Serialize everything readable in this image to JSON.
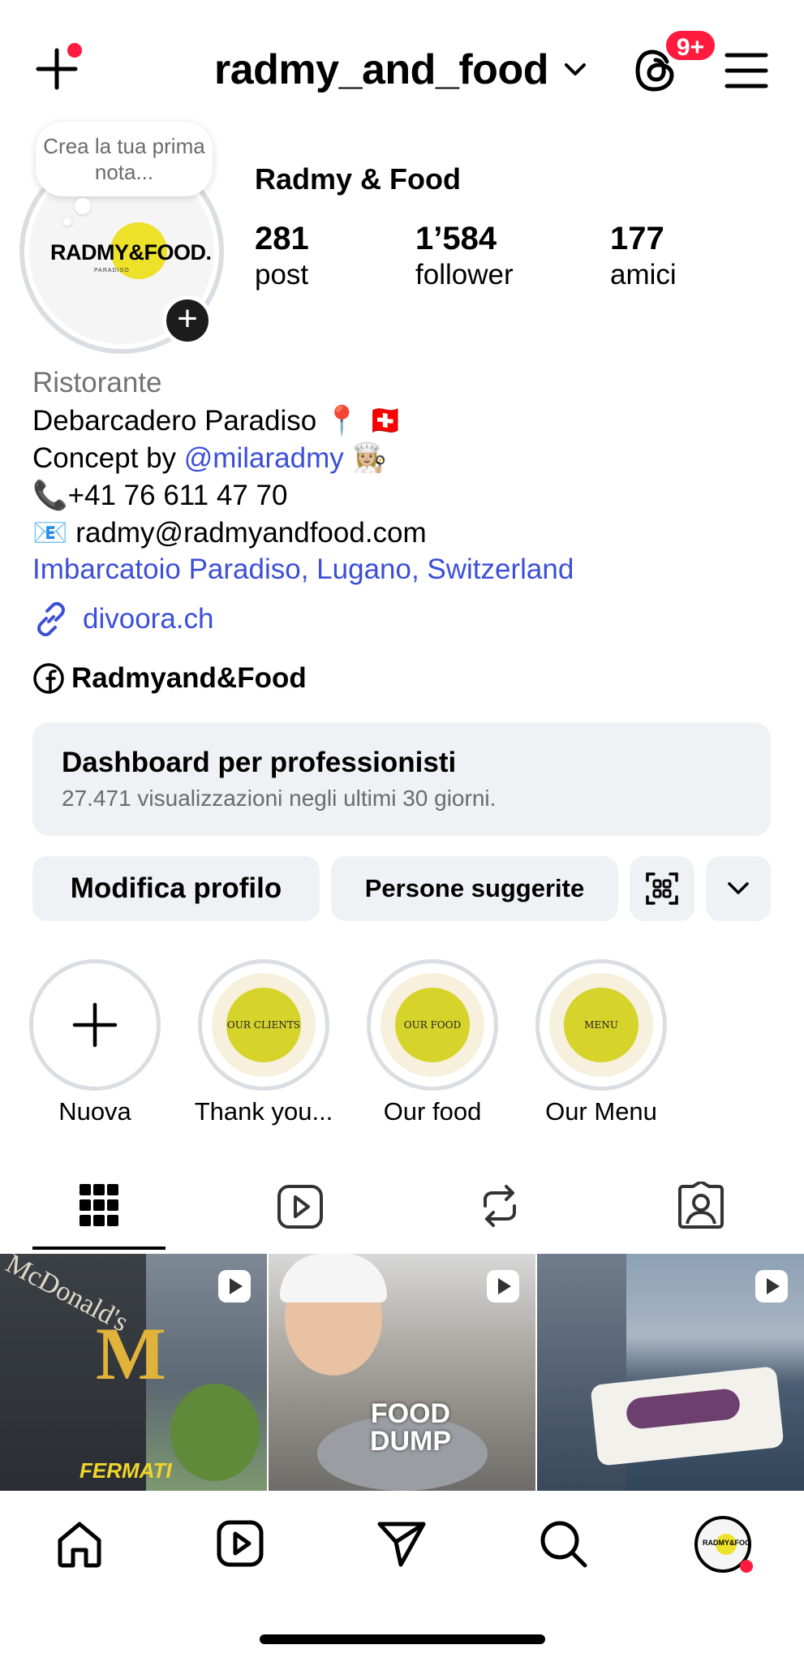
{
  "header": {
    "username": "radmy_and_food",
    "notification_badge": "9+"
  },
  "note": {
    "placeholder": "Crea la tua prima nota..."
  },
  "avatar": {
    "logo_text": "RADMY&FOOD.",
    "logo_subtext": "PARADISO"
  },
  "profile": {
    "display_name": "Radmy & Food",
    "stats": [
      {
        "value": "281",
        "label": "post"
      },
      {
        "value": "1’584",
        "label": "follower"
      },
      {
        "value": "177",
        "label": "amici"
      }
    ]
  },
  "bio": {
    "category": "Ristorante",
    "line1": "Debarcadero Paradiso 📍 🇨🇭",
    "line2_prefix": "Concept by ",
    "line2_mention": "@milaradmy",
    "line2_suffix": " 👩🏼‍🍳",
    "phone": "📞+41 76 611 47 70",
    "email": "📧 radmy@radmyandfood.com",
    "location": "Imbarcatoio Paradiso, Lugano, Switzerland",
    "website": "divoora.ch",
    "facebook": "Radmyand&Food"
  },
  "dashboard": {
    "title": "Dashboard per professionisti",
    "subtitle": "27.471 visualizzazioni negli ultimi 30 giorni."
  },
  "buttons": {
    "edit_profile": "Modifica profilo",
    "suggested": "Persone suggerite"
  },
  "highlights": [
    {
      "label": "Nuova",
      "cover": ""
    },
    {
      "label": "Thank you...",
      "cover": "OUR CLIENTS"
    },
    {
      "label": "Our food",
      "cover": "OUR FOOD"
    },
    {
      "label": "Our Menu",
      "cover": "MENU"
    }
  ],
  "grid": {
    "tiles": [
      {
        "caption": "FERMATI",
        "sign": "McDonald's"
      },
      {
        "caption": "FOOD DUMP"
      },
      {
        "caption": ""
      }
    ]
  },
  "colors": {
    "link": "#3b4fd8",
    "badge": "#ff1b3e",
    "button_bg": "#eff1f4",
    "logo_yellow": "#eee12a"
  }
}
